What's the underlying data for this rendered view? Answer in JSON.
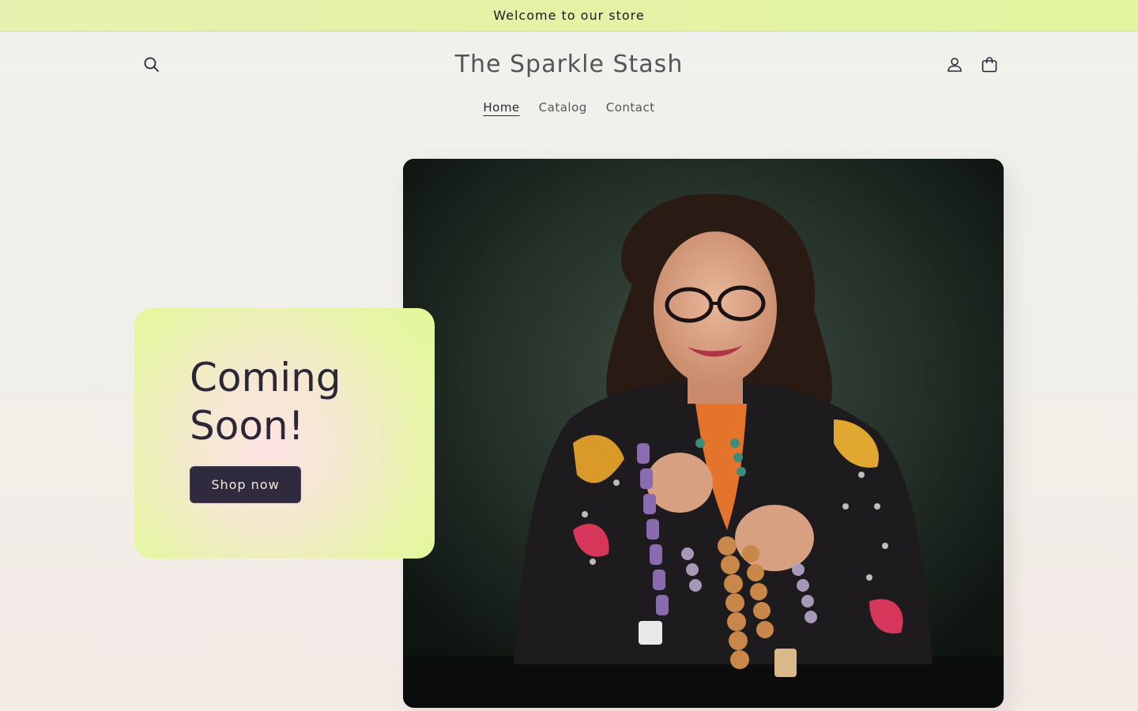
{
  "announcement": {
    "text": "Welcome to our store"
  },
  "header": {
    "logo": "The Sparkle Stash",
    "icons": {
      "search": "search-icon",
      "account": "account-icon",
      "cart": "cart-icon"
    }
  },
  "nav": {
    "items": [
      {
        "label": "Home",
        "active": true
      },
      {
        "label": "Catalog",
        "active": false
      },
      {
        "label": "Contact",
        "active": false
      }
    ]
  },
  "hero": {
    "title_line1": "Coming",
    "title_line2": "Soon!",
    "button_label": "Shop now"
  },
  "colors": {
    "announcement_bg": "#e4f2a6",
    "card_gradient": [
      "#fde3e3",
      "#e2f89a"
    ],
    "button_bg": "#2f2a3e",
    "text_dark": "#2a2535"
  }
}
